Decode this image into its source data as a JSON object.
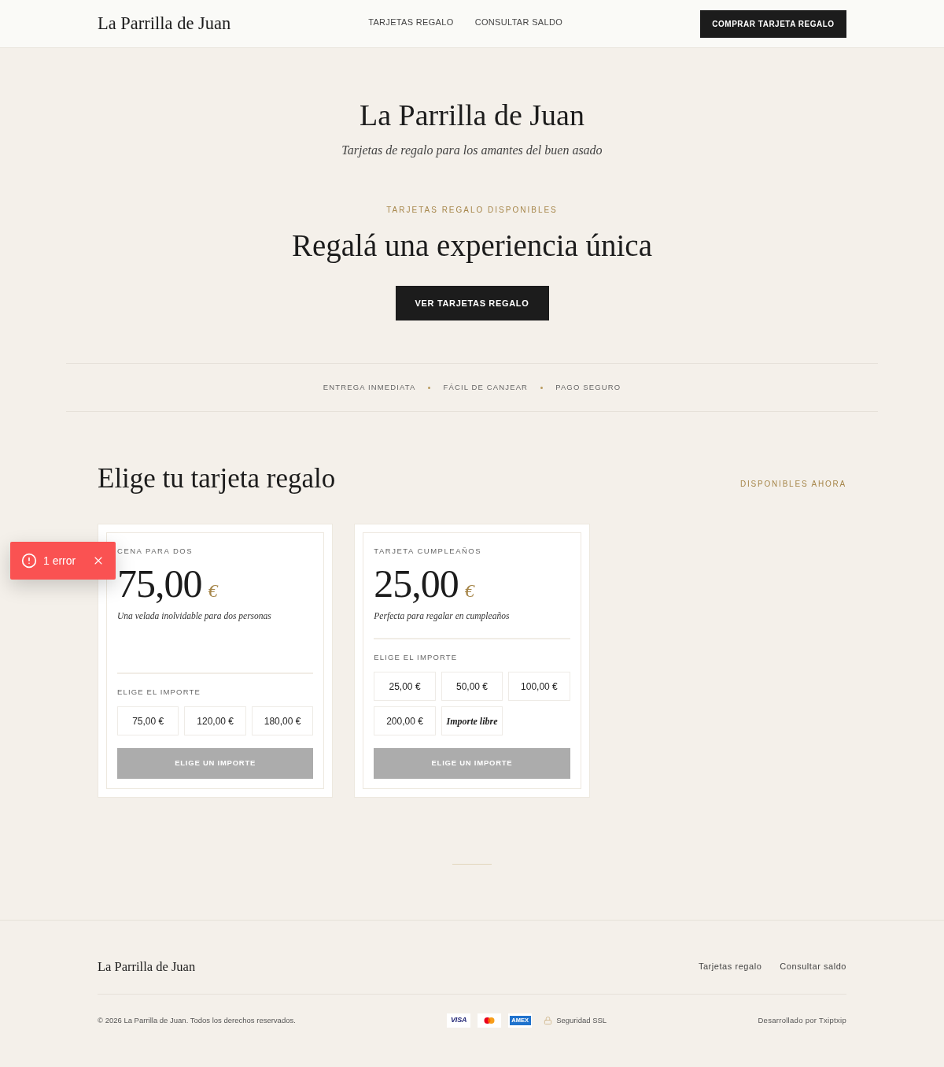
{
  "header": {
    "logo": "La Parrilla de Juan",
    "nav": [
      {
        "label": "TARJETAS REGALO"
      },
      {
        "label": "CONSULTAR SALDO"
      }
    ],
    "cta": "COMPRAR TARJETA REGALO"
  },
  "hero": {
    "title": "La Parrilla de Juan",
    "subtitle": "Tarjetas de regalo para los amantes del buen asado",
    "eyebrow": "TARJETAS REGALO DISPONIBLES",
    "heading": "Regalá una experiencia única",
    "button": "VER TARJETAS REGALO"
  },
  "features": [
    "ENTREGA INMEDIATA",
    "FÁCIL DE CANJEAR",
    "PAGO SEGURO"
  ],
  "cards_section": {
    "title": "Elige tu tarjeta regalo",
    "badge": "DISPONIBLES AHORA",
    "cards": [
      {
        "category": "CENA PARA DOS",
        "price": "75,00",
        "currency": "€",
        "description": "Una velada inolvidable para dos personas",
        "amount_label": "ELIGE EL IMPORTE",
        "options": [
          {
            "kind": "amount",
            "label": "75,00 €",
            "selected": false
          },
          {
            "kind": "amount",
            "label": "120,00 €",
            "selected": false
          },
          {
            "kind": "amount",
            "label": "180,00 €",
            "selected": false
          }
        ],
        "button": {
          "label": "ELIGE UN IMPORTE",
          "disabled": true
        }
      },
      {
        "category": "TARJETA CUMPLEAÑOS",
        "price": "25,00",
        "currency": "€",
        "description": "Perfecta para regalar en cumpleaños",
        "amount_label": "ELIGE EL IMPORTE",
        "options": [
          {
            "kind": "amount",
            "label": "25,00 €",
            "selected": false
          },
          {
            "kind": "amount",
            "label": "50,00 €",
            "selected": false
          },
          {
            "kind": "amount",
            "label": "100,00 €",
            "selected": false
          },
          {
            "kind": "amount",
            "label": "200,00 €",
            "selected": false
          },
          {
            "kind": "custom",
            "label": "Importe libre",
            "selected": false
          }
        ],
        "button": {
          "label": "ELIGE UN IMPORTE",
          "disabled": true
        }
      }
    ]
  },
  "toast": {
    "label": "1 error"
  },
  "footer": {
    "logo": "La Parrilla de Juan",
    "links": [
      "Tarjetas regalo",
      "Consultar saldo"
    ],
    "copyright": "© 2026 La Parrilla de Juan. Todos los derechos reservados.",
    "payment_methods": [
      {
        "kind": "visa",
        "label": "VISA"
      },
      {
        "kind": "mastercard"
      },
      {
        "kind": "amex",
        "label": "AMEX"
      }
    ],
    "security": "Seguridad SSL",
    "credit": "Desarrollado por Txiptxip"
  }
}
